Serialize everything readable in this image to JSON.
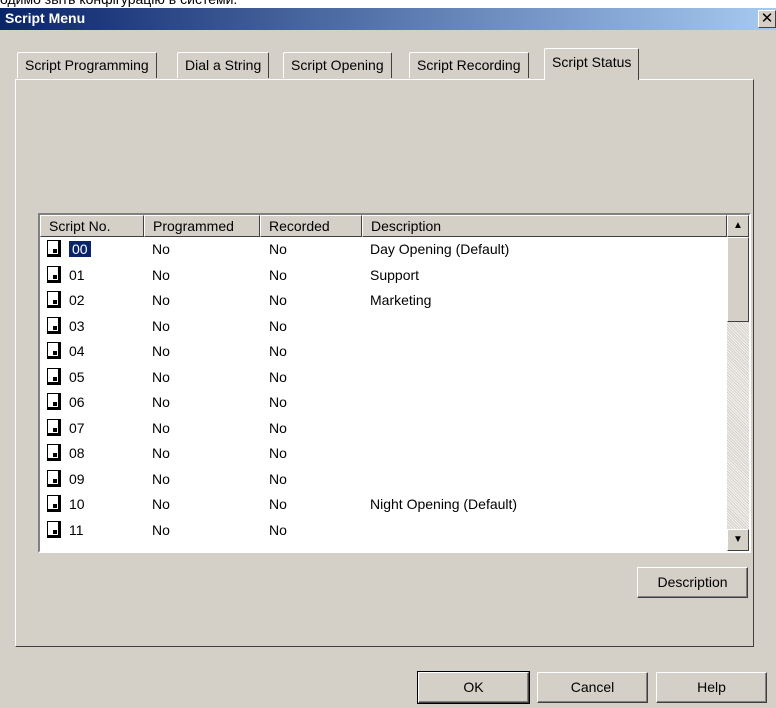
{
  "top_caption": "одимо звіть конфігурацію в системи.",
  "window": {
    "title": "Script Menu",
    "close_glyph": "✕"
  },
  "tabs": [
    {
      "label": "Script Programming"
    },
    {
      "label": "Dial a String"
    },
    {
      "label": "Script Opening"
    },
    {
      "label": "Script Recording"
    },
    {
      "label": "Script Status",
      "active": true
    }
  ],
  "list": {
    "columns": [
      "Script No.",
      "Programmed",
      "Recorded",
      "Description"
    ],
    "rows": [
      {
        "no": "00",
        "programmed": "No",
        "recorded": "No",
        "description": "Day Opening (Default)",
        "selected": true
      },
      {
        "no": "01",
        "programmed": "No",
        "recorded": "No",
        "description": "Support"
      },
      {
        "no": "02",
        "programmed": "No",
        "recorded": "No",
        "description": "Marketing"
      },
      {
        "no": "03",
        "programmed": "No",
        "recorded": "No",
        "description": ""
      },
      {
        "no": "04",
        "programmed": "No",
        "recorded": "No",
        "description": ""
      },
      {
        "no": "05",
        "programmed": "No",
        "recorded": "No",
        "description": ""
      },
      {
        "no": "06",
        "programmed": "No",
        "recorded": "No",
        "description": ""
      },
      {
        "no": "07",
        "programmed": "No",
        "recorded": "No",
        "description": ""
      },
      {
        "no": "08",
        "programmed": "No",
        "recorded": "No",
        "description": ""
      },
      {
        "no": "09",
        "programmed": "No",
        "recorded": "No",
        "description": ""
      },
      {
        "no": "10",
        "programmed": "No",
        "recorded": "No",
        "description": "Night Opening (Default)"
      },
      {
        "no": "11",
        "programmed": "No",
        "recorded": "No",
        "description": ""
      }
    ],
    "scroll_up_glyph": "▲",
    "scroll_down_glyph": "▼",
    "row_icon": "document-icon"
  },
  "buttons": {
    "description": "Description",
    "ok": "OK",
    "cancel": "Cancel",
    "help": "Help"
  },
  "colors": {
    "title_start": "#0a246a",
    "title_end": "#a6caf0",
    "face": "#d4d0c8",
    "selection": "#0a246a"
  }
}
